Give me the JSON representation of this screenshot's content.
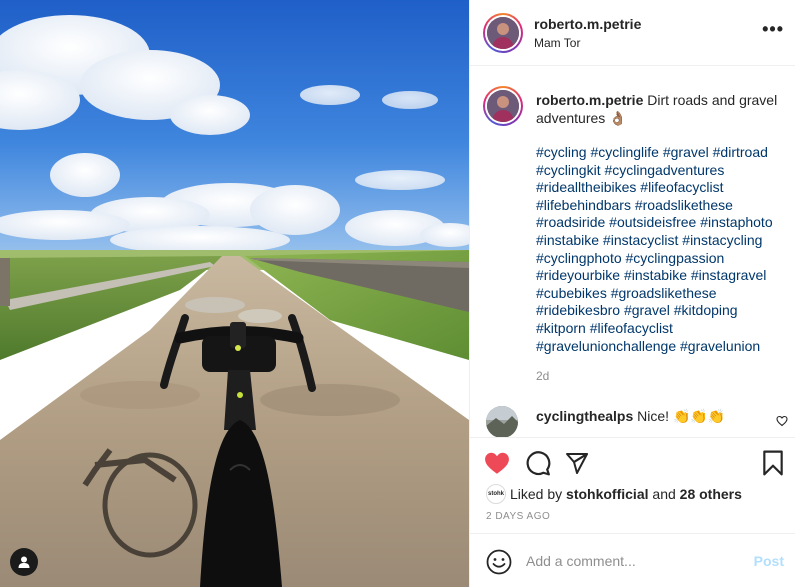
{
  "post": {
    "username": "roberto.m.petrie",
    "location": "Mam Tor",
    "more_label": "•••",
    "caption": "Dirt roads and gravel adventures 👌🏽",
    "hashtags": "#cycling #cyclinglife #gravel #dirtroad #cyclingkit #cyclingadventures #ridealltheibikes #lifeofacyclist #lifebehindbars #roadslikethese #roadsiride #outsideisfree #instaphoto #instabike #instacyclist #instacycling #cyclingphoto #cyclingpassion #rideyourbike #instabike #instagravel #cubebikes #groadslikethese #ridebikesbro #gravel #kitdoping #kitporn #lifeofacyclist #gravelunionchallenge #gravelunion",
    "age": "2d"
  },
  "comment": {
    "username": "cyclingthealps",
    "text": "Nice! 👏👏👏"
  },
  "likes": {
    "avatar_text": "stohk",
    "prefix": "Liked by ",
    "user": "stohkofficial",
    "middle": " and ",
    "count": "28 others"
  },
  "date": "2 DAYS AGO",
  "add_comment": {
    "placeholder": "Add a comment...",
    "post_label": "Post"
  },
  "colors": {
    "liked_heart": "#ed4956",
    "hashtag": "#00376b",
    "post_disabled": "#b2dffc"
  },
  "icons": [
    "user-tag-icon",
    "more-options-icon",
    "heart-icon",
    "comment-icon",
    "share-icon",
    "bookmark-icon",
    "emoji-icon",
    "small-heart-icon"
  ]
}
